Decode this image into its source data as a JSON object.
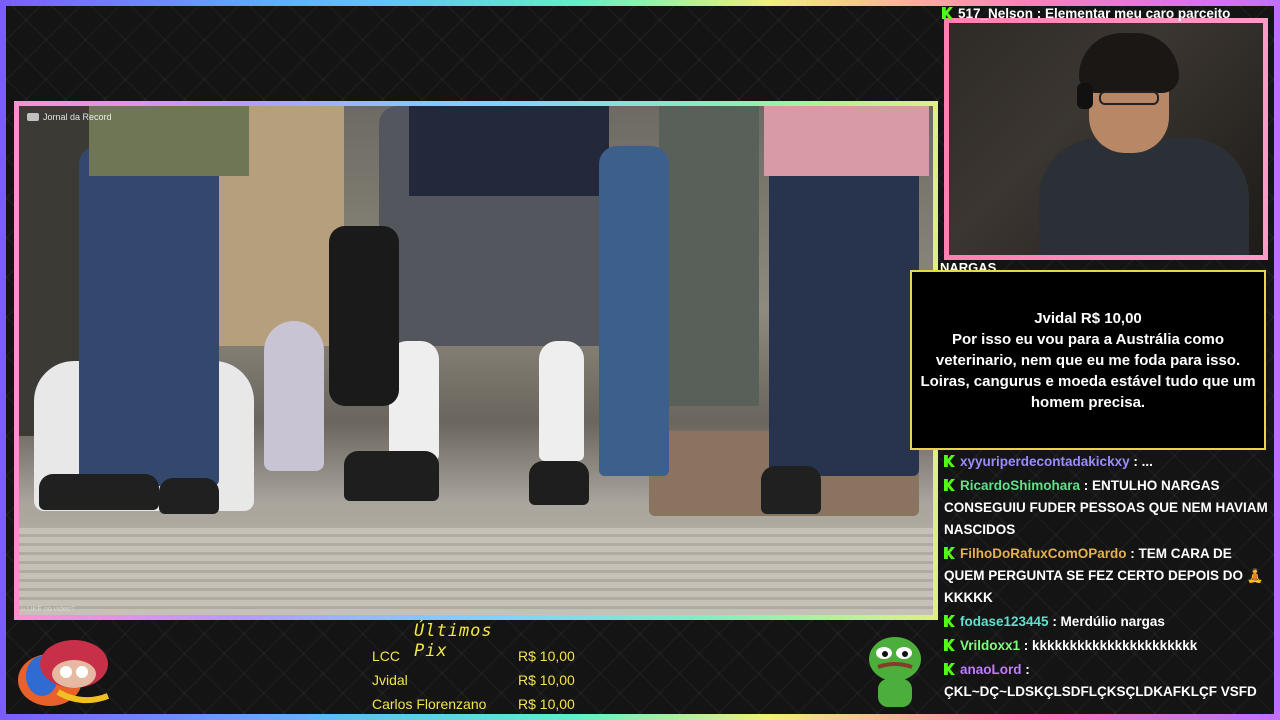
{
  "video": {
    "watermark": "Jornal da Record",
    "corner_text": "u LIKE no vídeo?"
  },
  "chat": {
    "top_line": "517_Nelson : Elementar meu caro parceito",
    "partial_line": "NARGAS",
    "messages": [
      {
        "user": "xyyuriperdecontadakickxy",
        "user_color": "#9a8cff",
        "text": " : ..."
      },
      {
        "user": "RicardoShimohara",
        "user_color": "#5fe08a",
        "text": " : ENTULHO NARGAS CONSEGUIU FUDER PESSOAS QUE NEM HAVIAM NASCIDOS"
      },
      {
        "user": "FilhoDoRafuxComOPardo",
        "user_color": "#e6b04a",
        "text": " : TEM CARA DE QUEM PERGUNTA SE FEZ CERTO DEPOIS DO 🧘 KKKKK"
      },
      {
        "user": "fodase123445",
        "user_color": "#5fe0d0",
        "text": " : Merdúlio nargas"
      },
      {
        "user": "Vrildoxx1",
        "user_color": "#7dff7a",
        "text": " : kkkkkkkkkkkkkkkkkkkkkk"
      },
      {
        "user": "anaoLord",
        "user_color": "#c07cff",
        "text": " : ÇKL~DÇ~LDSKÇLSDFLÇKSÇLDKAFKLÇF VSFD"
      }
    ],
    "badge_color": "#53fc18"
  },
  "alert": {
    "donor_line": "Jvidal R$ 10,00",
    "message": "Por isso eu vou para a Austrália como veterinario, nem que eu me foda para isso. Loiras, cangurus e moeda estável tudo que um homem precisa."
  },
  "pix": {
    "title": "Últimos Pix",
    "rows": [
      {
        "name": "LCC",
        "value": "R$ 10,00"
      },
      {
        "name": "Jvidal",
        "value": "R$ 10,00"
      },
      {
        "name": "Carlos Florenzano",
        "value": "R$ 10,00"
      }
    ]
  },
  "colors": {
    "pix_text": "#f2e44b",
    "alert_border": "#e9d44a",
    "cam_border": "#ff8fbf"
  }
}
